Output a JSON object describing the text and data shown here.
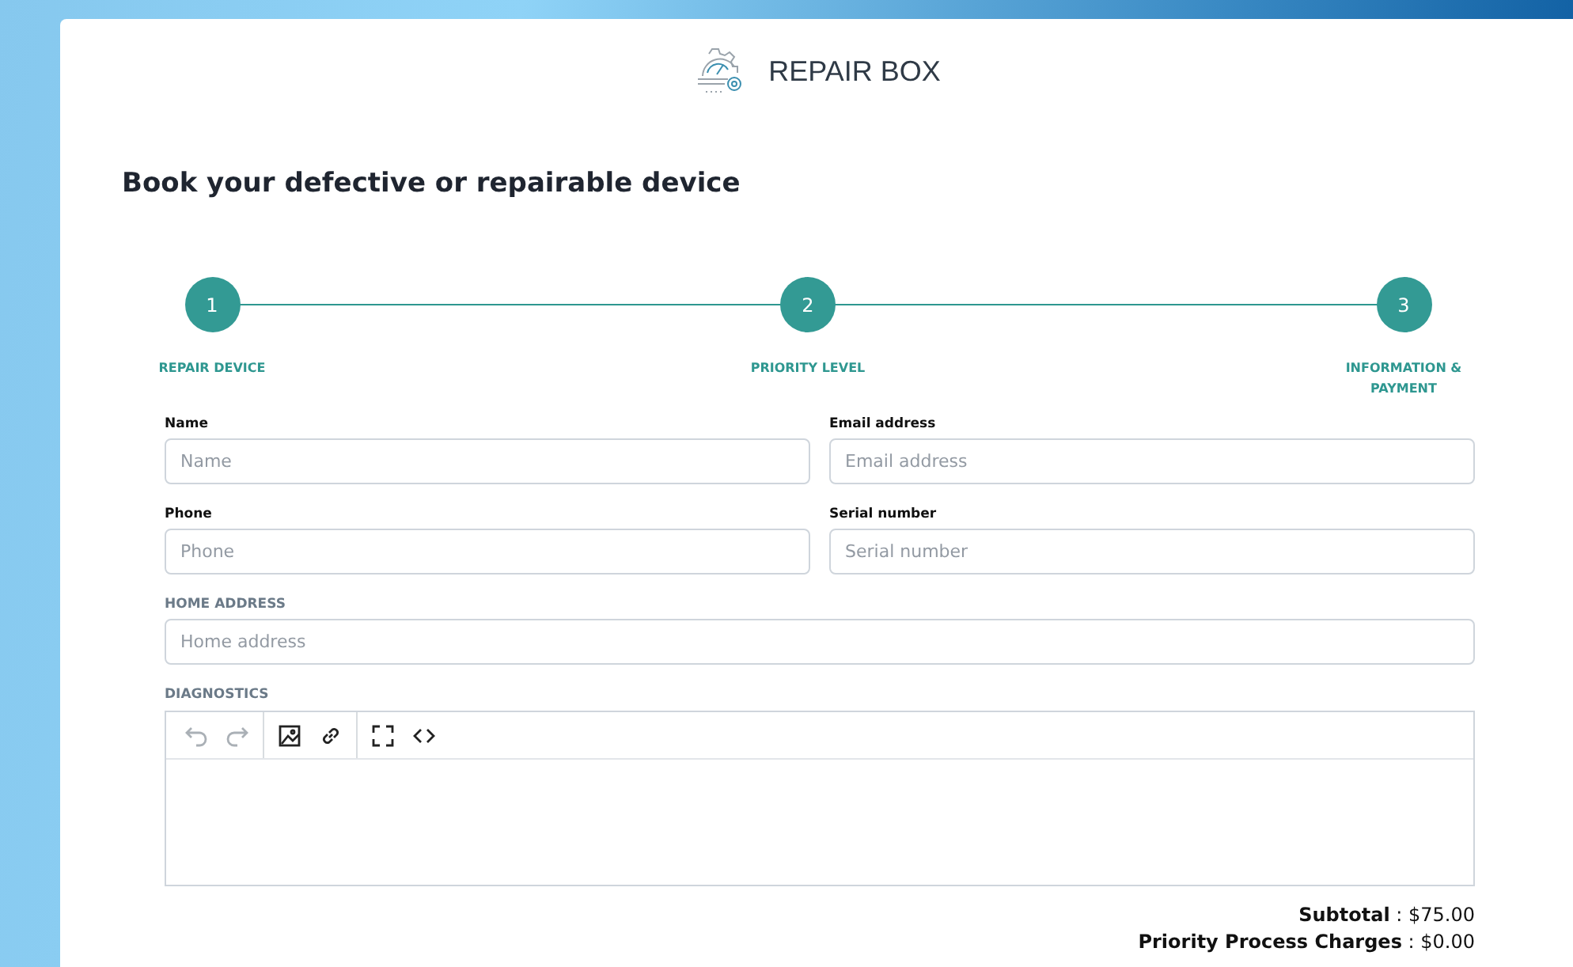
{
  "brand": {
    "name": "REPAIR BOX"
  },
  "heading": "Book your defective or repairable device",
  "steps": [
    {
      "number": "1",
      "label": "REPAIR DEVICE",
      "selected": true
    },
    {
      "number": "2",
      "label": "PRIORITY LEVEL",
      "selected": true
    },
    {
      "number": "3",
      "label": "INFORMATION & PAYMENT",
      "selected": true
    }
  ],
  "fields": [
    {
      "kind": "half",
      "label": "Name",
      "placeholder": "Name"
    },
    {
      "kind": "half",
      "label": "Email address",
      "placeholder": "Email address"
    },
    {
      "kind": "half",
      "label": "Phone",
      "placeholder": "Phone"
    },
    {
      "kind": "half",
      "label": "Serial number",
      "placeholder": "Serial number"
    },
    {
      "kind": "full",
      "label": "HOME ADDRESS",
      "placeholder": "Home address"
    }
  ],
  "editor": {
    "label": "DIAGNOSTICS",
    "tools": [
      {
        "kind": "undo",
        "disabled": true
      },
      {
        "kind": "redo",
        "disabled": true
      },
      {
        "kind": "image",
        "disabled": false
      },
      {
        "kind": "link",
        "disabled": false
      },
      {
        "kind": "fullscreen",
        "disabled": false
      },
      {
        "kind": "code",
        "disabled": false
      }
    ]
  },
  "totals": [
    "**Subtotal** : $75.00",
    "**Priority Process Charges** : $0.00"
  ]
}
